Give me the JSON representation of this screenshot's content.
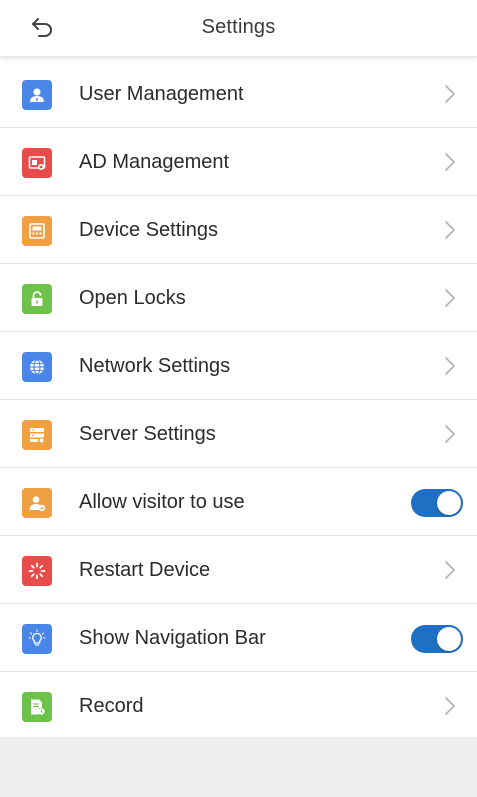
{
  "header": {
    "title": "Settings",
    "back_icon": "back-arrow-icon"
  },
  "colors": {
    "toggle_on": "#1f6fc4",
    "chevron": "#b0b0b0"
  },
  "items": [
    {
      "label": "User Management",
      "icon": "user-icon",
      "icon_color": "#4a86e8",
      "control": "chevron"
    },
    {
      "label": "AD Management",
      "icon": "ad-icon",
      "icon_color": "#e84b4b",
      "control": "chevron"
    },
    {
      "label": "Device Settings",
      "icon": "device-icon",
      "icon_color": "#f0a040",
      "control": "chevron"
    },
    {
      "label": "Open Locks",
      "icon": "lock-icon",
      "icon_color": "#6cc24a",
      "control": "chevron"
    },
    {
      "label": "Network Settings",
      "icon": "globe-icon",
      "icon_color": "#4a86e8",
      "control": "chevron"
    },
    {
      "label": "Server Settings",
      "icon": "server-icon",
      "icon_color": "#f0a040",
      "control": "chevron"
    },
    {
      "label": "Allow visitor to use",
      "icon": "visitor-icon",
      "icon_color": "#f0a040",
      "control": "toggle",
      "toggle_on": true
    },
    {
      "label": "Restart Device",
      "icon": "restart-icon",
      "icon_color": "#e84b4b",
      "control": "chevron"
    },
    {
      "label": "Show Navigation Bar",
      "icon": "lightbulb-icon",
      "icon_color": "#4a86e8",
      "control": "toggle",
      "toggle_on": true
    },
    {
      "label": "Record",
      "icon": "record-icon",
      "icon_color": "#6cc24a",
      "control": "chevron"
    }
  ]
}
